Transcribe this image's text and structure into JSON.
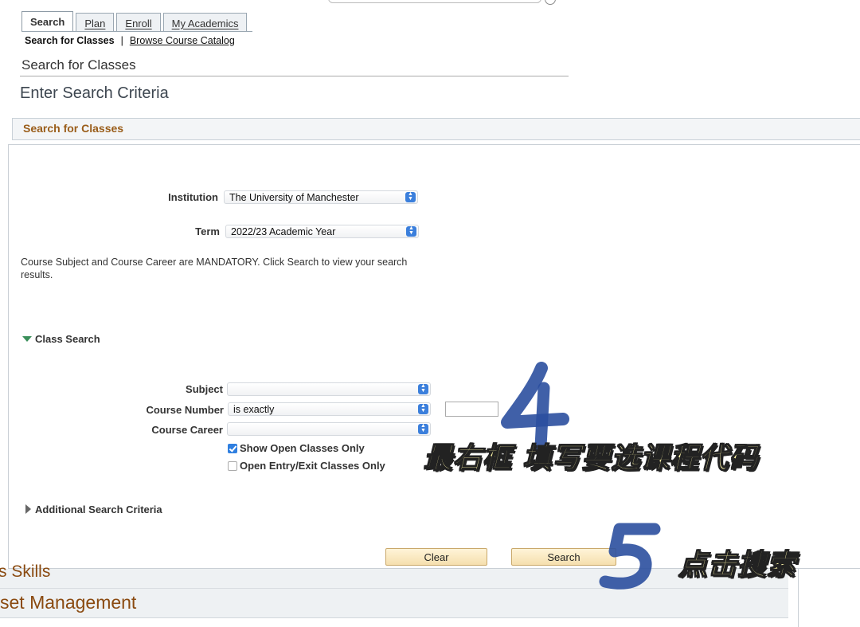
{
  "tabs": [
    {
      "label": "Search",
      "active": true
    },
    {
      "label": "Plan",
      "active": false
    },
    {
      "label": "Enroll",
      "active": false
    },
    {
      "label": "My Academics",
      "active": false
    }
  ],
  "subnav": {
    "current": "Search for Classes",
    "separator": "|",
    "link": "Browse Course Catalog"
  },
  "page_subtitle": "Search for Classes",
  "page_title": "Enter Search Criteria",
  "section_header": "Search for Classes",
  "form": {
    "institution_label": "Institution",
    "institution_value": "The University of Manchester",
    "term_label": "Term",
    "term_value": "2022/23 Academic Year",
    "note": "Course Subject and Course Career are MANDATORY. Click Search to view your search results.",
    "class_search_label": "Class Search",
    "subject_label": "Subject",
    "subject_value": "",
    "course_number_label": "Course Number",
    "course_number_operator": "is exactly",
    "course_number_value": "",
    "course_career_label": "Course Career",
    "course_career_value": "",
    "show_open_label": "Show Open Classes Only",
    "show_open_checked": true,
    "open_entry_label": "Open Entry/Exit Classes Only",
    "open_entry_checked": false,
    "additional_label": "Additional Search Criteria"
  },
  "buttons": {
    "clear": "Clear",
    "search": "Search"
  },
  "background": {
    "row1": "s Skills",
    "row2": "set Management"
  },
  "annotations": {
    "step4_number": "4",
    "step4_text": "最右框 填写要选课程代码",
    "step5_number": "5",
    "step5_text": "点击搜索"
  },
  "colors": {
    "section_header_text": "#9a5d1a",
    "button_bg": "#f5dfae",
    "annotation_marker": "#2b4f9e",
    "annotation_text": "#fff7a8"
  }
}
